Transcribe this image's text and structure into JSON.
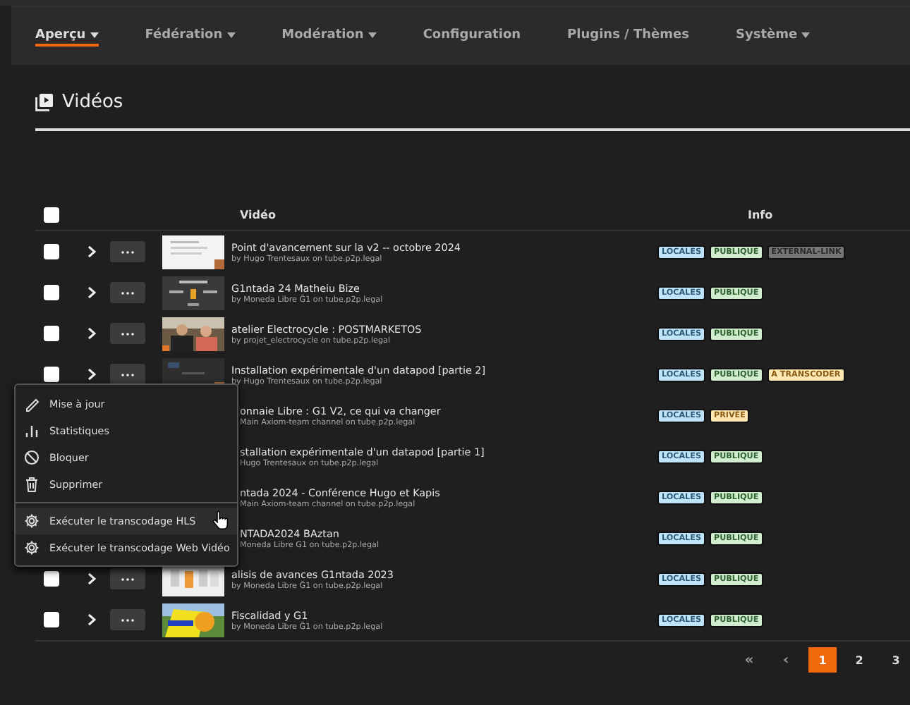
{
  "nav": [
    {
      "label": "Aperçu",
      "dropdown": true,
      "selected": true
    },
    {
      "label": "Fédération",
      "dropdown": true,
      "selected": false
    },
    {
      "label": "Modération",
      "dropdown": true,
      "selected": false
    },
    {
      "label": "Configuration",
      "dropdown": false,
      "selected": false
    },
    {
      "label": "Plugins / Thèmes",
      "dropdown": false,
      "selected": false
    },
    {
      "label": "Système",
      "dropdown": true,
      "selected": false
    }
  ],
  "page_title": "Vidéos",
  "table": {
    "select_all_checked": false,
    "columns": [
      "Vidéo",
      "Info"
    ],
    "rows": [
      {
        "title": "Point d'avancement sur la v2 -- octobre 2024",
        "byline": "by Hugo Trentesaux on tube.p2p.legal",
        "covered": false,
        "checked": false,
        "tags": [
          {
            "label": "LOCALES",
            "kind": "locales"
          },
          {
            "label": "PUBLIQUE",
            "kind": "publique"
          },
          {
            "label": "EXTERNAL-LINK",
            "kind": "external"
          }
        ]
      },
      {
        "title": "G1ntada 24 Matheiu Bize",
        "byline": "by Moneda Libre Ğ1 on tube.p2p.legal",
        "covered": false,
        "checked": false,
        "tags": [
          {
            "label": "LOCALES",
            "kind": "locales"
          },
          {
            "label": "PUBLIQUE",
            "kind": "publique"
          }
        ]
      },
      {
        "title": "atelier Electrocycle : POSTMARKETOS",
        "byline": "by projet_electrocycle on tube.p2p.legal",
        "covered": false,
        "checked": false,
        "tags": [
          {
            "label": "LOCALES",
            "kind": "locales"
          },
          {
            "label": "PUBLIQUE",
            "kind": "publique"
          }
        ]
      },
      {
        "title": "Installation expérimentale d'un datapod [partie 2]",
        "byline": "by Hugo Trentesaux on tube.p2p.legal",
        "covered": false,
        "checked": false,
        "tags": [
          {
            "label": "LOCALES",
            "kind": "locales"
          },
          {
            "label": "PUBLIQUE",
            "kind": "publique"
          },
          {
            "label": "À TRANSCODER",
            "kind": "warning"
          }
        ]
      },
      {
        "title": "onnaie Libre : G1 V2, ce qui va changer",
        "byline": "Main Axiom-team channel on tube.p2p.legal",
        "covered": true,
        "tags": [
          {
            "label": "LOCALES",
            "kind": "locales"
          },
          {
            "label": "PRIVÉE",
            "kind": "warning"
          }
        ]
      },
      {
        "title": "stallation expérimentale d'un datapod [partie 1]",
        "byline": "Hugo Trentesaux on tube.p2p.legal",
        "covered": true,
        "tags": [
          {
            "label": "LOCALES",
            "kind": "locales"
          },
          {
            "label": "PUBLIQUE",
            "kind": "publique"
          }
        ]
      },
      {
        "title": "ntada 2024 - Conférence Hugo et Kapis",
        "byline": "Main Axiom-team channel on tube.p2p.legal",
        "covered": true,
        "tags": [
          {
            "label": "LOCALES",
            "kind": "locales"
          },
          {
            "label": "PUBLIQUE",
            "kind": "publique"
          }
        ]
      },
      {
        "title": "NTADA2024 BAztan",
        "byline": "Moneda Libre G1 on tube.p2p.legal",
        "covered": true,
        "tags": [
          {
            "label": "LOCALES",
            "kind": "locales"
          },
          {
            "label": "PUBLIQUE",
            "kind": "publique"
          }
        ]
      },
      {
        "title": "alisis de avances G1ntada 2023",
        "byline": "by Moneda Libre Ğ1 on tube.p2p.legal",
        "covered": false,
        "checked": false,
        "tags": [
          {
            "label": "LOCALES",
            "kind": "locales"
          },
          {
            "label": "PUBLIQUE",
            "kind": "publique"
          }
        ]
      },
      {
        "title": "Fiscalidad y G1",
        "byline": "by Moneda Libre Ğ1 on tube.p2p.legal",
        "covered": false,
        "checked": false,
        "tags": [
          {
            "label": "LOCALES",
            "kind": "locales"
          },
          {
            "label": "PUBLIQUE",
            "kind": "publique"
          }
        ]
      }
    ]
  },
  "context_menu": [
    {
      "label": "Mise à jour",
      "kind": "edit",
      "hovered": false
    },
    {
      "label": "Statistiques",
      "kind": "stats",
      "hovered": false
    },
    {
      "label": "Bloquer",
      "kind": "block",
      "hovered": false
    },
    {
      "label": "Supprimer",
      "kind": "delete",
      "hovered": false
    },
    {
      "label": "Exécuter le transcodage HLS",
      "kind": "run",
      "hovered": true
    },
    {
      "label": "Exécuter le transcodage Web Vidéo",
      "kind": "run",
      "hovered": false
    }
  ],
  "pagination": [
    {
      "label": "«",
      "kind": "first",
      "selected": false
    },
    {
      "label": "‹",
      "kind": "prev",
      "selected": false
    },
    {
      "label": "1",
      "kind": "page",
      "selected": true
    },
    {
      "label": "2",
      "kind": "page",
      "selected": false
    },
    {
      "label": "3",
      "kind": "page",
      "selected": false
    }
  ]
}
